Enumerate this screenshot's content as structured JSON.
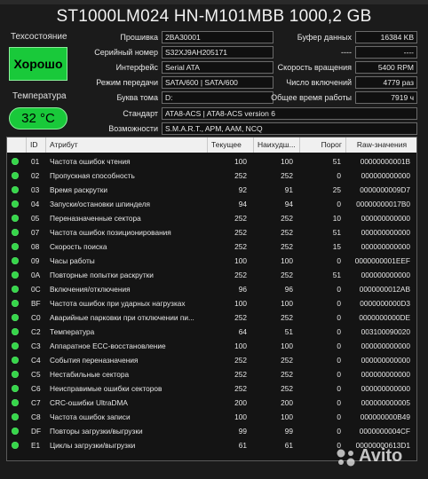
{
  "title": "ST1000LM024 HN-M101MBB 1000,2 GB",
  "status": {
    "health_label": "Техсостояние",
    "health_value": "Хорошо",
    "temp_label": "Температура",
    "temp_value": "32 °C"
  },
  "info_left": [
    {
      "label": "Прошивка",
      "value": "2BA30001"
    },
    {
      "label": "Серийный номер",
      "value": "S32XJ9AH205171"
    },
    {
      "label": "Интерфейс",
      "value": "Serial ATA"
    },
    {
      "label": "Режим передачи",
      "value": "SATA/600 | SATA/600"
    },
    {
      "label": "Буква тома",
      "value": "D:"
    }
  ],
  "info_right": [
    {
      "label": "Буфер данных",
      "value": "16384 KB"
    },
    {
      "label": "----",
      "value": "----"
    },
    {
      "label": "Скорость вращения",
      "value": "5400 RPM"
    },
    {
      "label": "Число включений",
      "value": "4779 раз"
    },
    {
      "label": "Общее время работы",
      "value": "7919 ч"
    }
  ],
  "standard": {
    "label": "Стандарт",
    "value": "ATA8-ACS | ATA8-ACS version 6"
  },
  "features": {
    "label": "Возможности",
    "value": "S.M.A.R.T., APM, AAM, NCQ"
  },
  "table": {
    "headers": [
      "ID",
      "Атрибут",
      "Текущее",
      "Наихудш...",
      "Порог",
      "Raw-значения"
    ],
    "rows": [
      {
        "id": "01",
        "attr": "Частота ошибок чтения",
        "cur": "100",
        "worst": "100",
        "thr": "51",
        "raw": "00000000001B"
      },
      {
        "id": "02",
        "attr": "Пропускная способность",
        "cur": "252",
        "worst": "252",
        "thr": "0",
        "raw": "000000000000"
      },
      {
        "id": "03",
        "attr": "Время раскрутки",
        "cur": "92",
        "worst": "91",
        "thr": "25",
        "raw": "0000000009D7"
      },
      {
        "id": "04",
        "attr": "Запуски/остановки шпинделя",
        "cur": "94",
        "worst": "94",
        "thr": "0",
        "raw": "00000000017B0"
      },
      {
        "id": "05",
        "attr": "Переназначенные сектора",
        "cur": "252",
        "worst": "252",
        "thr": "10",
        "raw": "000000000000"
      },
      {
        "id": "07",
        "attr": "Частота ошибок позиционирования",
        "cur": "252",
        "worst": "252",
        "thr": "51",
        "raw": "000000000000"
      },
      {
        "id": "08",
        "attr": "Скорость поиска",
        "cur": "252",
        "worst": "252",
        "thr": "15",
        "raw": "000000000000"
      },
      {
        "id": "09",
        "attr": "Часы работы",
        "cur": "100",
        "worst": "100",
        "thr": "0",
        "raw": "0000000001EEF"
      },
      {
        "id": "0A",
        "attr": "Повторные попытки раскрутки",
        "cur": "252",
        "worst": "252",
        "thr": "51",
        "raw": "000000000000"
      },
      {
        "id": "0C",
        "attr": "Включения/отключения",
        "cur": "96",
        "worst": "96",
        "thr": "0",
        "raw": "0000000012AB"
      },
      {
        "id": "BF",
        "attr": "Частота ошибок при ударных нагрузках",
        "cur": "100",
        "worst": "100",
        "thr": "0",
        "raw": "0000000000D3"
      },
      {
        "id": "C0",
        "attr": "Аварийные парковки при отключении пи...",
        "cur": "252",
        "worst": "252",
        "thr": "0",
        "raw": "0000000000DE"
      },
      {
        "id": "C2",
        "attr": "Температура",
        "cur": "64",
        "worst": "51",
        "thr": "0",
        "raw": "003100090020"
      },
      {
        "id": "C3",
        "attr": "Аппаратное ECC-восстановление",
        "cur": "100",
        "worst": "100",
        "thr": "0",
        "raw": "000000000000"
      },
      {
        "id": "C4",
        "attr": "События переназначения",
        "cur": "252",
        "worst": "252",
        "thr": "0",
        "raw": "000000000000"
      },
      {
        "id": "C5",
        "attr": "Нестабильные сектора",
        "cur": "252",
        "worst": "252",
        "thr": "0",
        "raw": "000000000000"
      },
      {
        "id": "C6",
        "attr": "Неисправимые ошибки секторов",
        "cur": "252",
        "worst": "252",
        "thr": "0",
        "raw": "000000000000"
      },
      {
        "id": "C7",
        "attr": "CRC-ошибки UltraDMA",
        "cur": "200",
        "worst": "200",
        "thr": "0",
        "raw": "000000000005"
      },
      {
        "id": "C8",
        "attr": "Частота ошибок записи",
        "cur": "100",
        "worst": "100",
        "thr": "0",
        "raw": "000000000B49"
      },
      {
        "id": "DF",
        "attr": "Повторы загрузки/выгрузки",
        "cur": "99",
        "worst": "99",
        "thr": "0",
        "raw": "0000000004CF"
      },
      {
        "id": "E1",
        "attr": "Циклы загрузки/выгрузки",
        "cur": "61",
        "worst": "61",
        "thr": "0",
        "raw": "00000000613D1"
      }
    ]
  },
  "watermark": "Avito",
  "colors": {
    "good": "#19c93a",
    "background": "#1b1b1b",
    "header_bg": "#f0f0f0"
  }
}
